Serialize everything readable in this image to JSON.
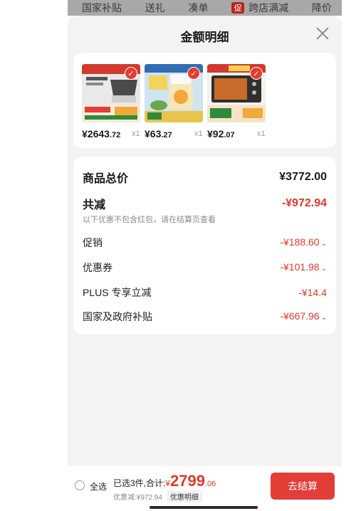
{
  "top_strip": {
    "items": [
      "国家补贴",
      "送礼",
      "凑单",
      "跨店满减",
      "降价"
    ],
    "tag": "促"
  },
  "sheet": {
    "title": "金额明细"
  },
  "products": [
    {
      "price_int": "¥2643",
      "price_dec": ".72",
      "qty": "x1",
      "accent": "#b8b8b8"
    },
    {
      "price_int": "¥63",
      "price_dec": ".27",
      "qty": "x1",
      "accent": "#f0c44a"
    },
    {
      "price_int": "¥92",
      "price_dec": ".07",
      "qty": "x1",
      "accent": "#3a3a3a"
    }
  ],
  "summary": {
    "total_label": "商品总价",
    "total_value": "¥3772.00",
    "reduce_label": "共减",
    "reduce_value": "-¥972.94",
    "reduce_note": "以下优惠不包含红包，请在结算页查看",
    "items": [
      {
        "label": "促销",
        "value": "-¥188.60"
      },
      {
        "label": "优惠券",
        "value": "-¥101.98"
      },
      {
        "label": "PLUS 专享立减",
        "value": "-¥14.4"
      },
      {
        "label": "国家及政府补贴",
        "value": "-¥667.96"
      }
    ]
  },
  "bottom": {
    "select_all": "全选",
    "selected_prefix": "已选3件,合计:",
    "currency": "¥",
    "total_int": "2799",
    "total_dec": ".06",
    "discount_text": "优惠减:¥972.94",
    "discount_button": "优惠明细",
    "checkout": "去结算"
  },
  "colors": {
    "accent_red": "#e0392b",
    "checkout_bg": "#e23d37",
    "sheet_bg": "#f3f3f3"
  }
}
